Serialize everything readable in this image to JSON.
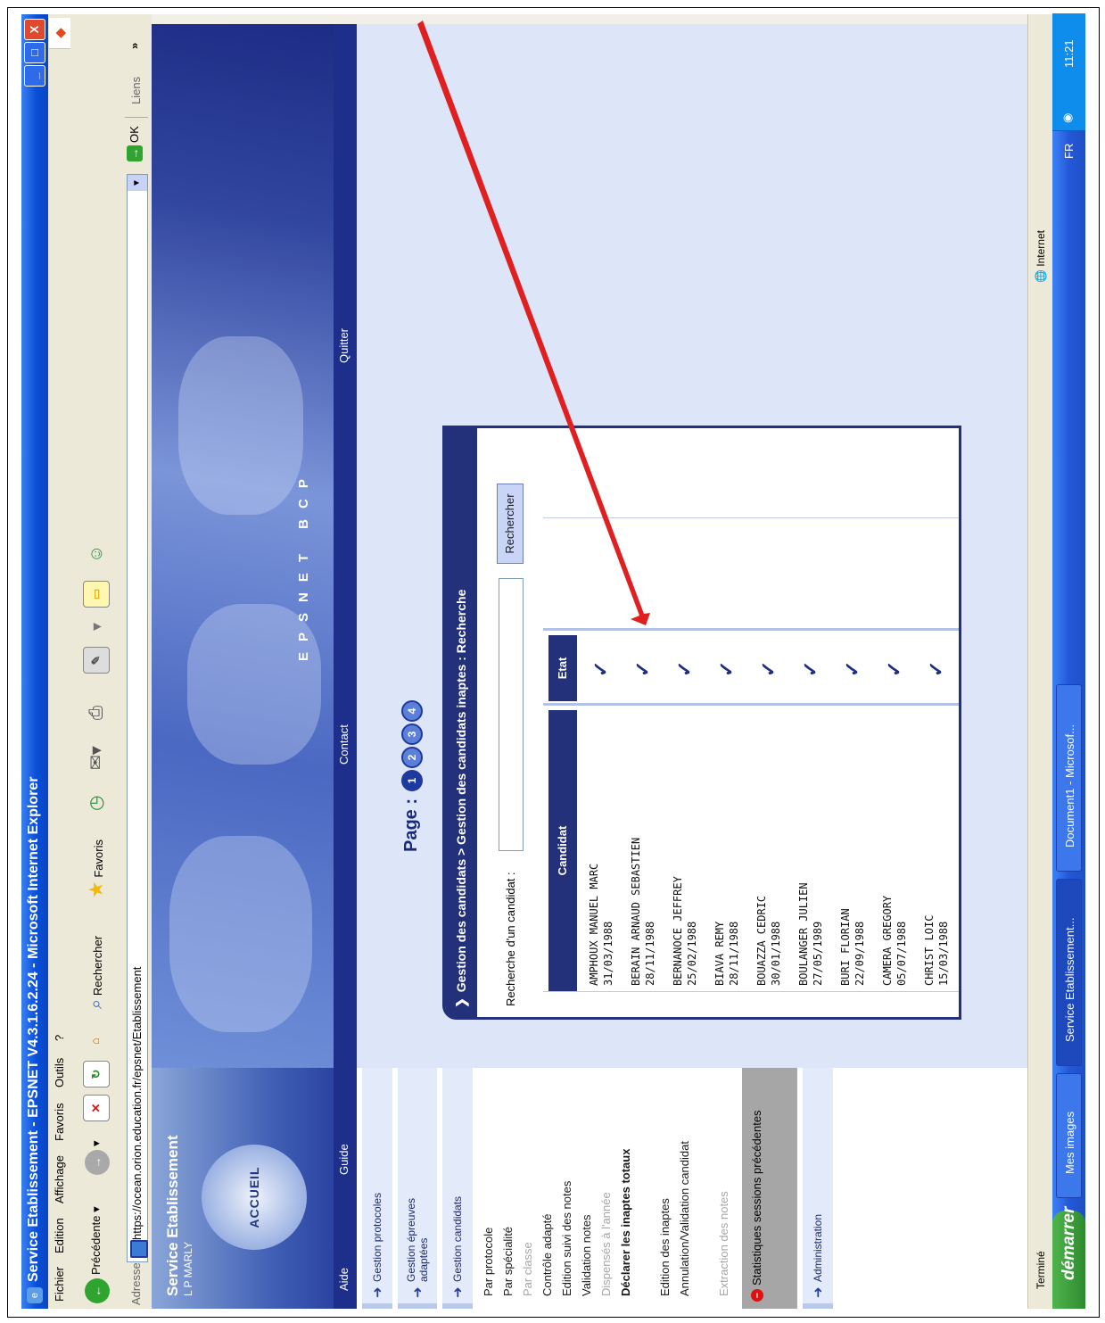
{
  "window": {
    "title": "Service Etablissement - EPSNET V4.3.1.6.2.24 - Microsoft Internet Explorer",
    "minimize": "_",
    "maximize": "□",
    "close": "X"
  },
  "menu": [
    "Fichier",
    "Edition",
    "Affichage",
    "Favoris",
    "Outils",
    "?"
  ],
  "toolbar": {
    "back": "Précédente",
    "search": "Rechercher",
    "favorites": "Favoris"
  },
  "address": {
    "label": "Adresse",
    "url": "https://ocean.orion.education.fr/epsnet/Etablissement",
    "go": "OK",
    "links": "Liens",
    "more": "»"
  },
  "sidebar": {
    "title": "Service Etablissement",
    "subtitle": "L P MARLY",
    "home": "ACCUEIL",
    "nav_left": [
      "Aide",
      "Guide"
    ],
    "sections": {
      "protocoles": "Gestion protocoles",
      "epreuves": "Gestion épreuves adaptées",
      "candidats": "Gestion candidats",
      "administration": "Administration"
    },
    "items": [
      "Par protocole",
      "Par spécialité",
      "Par classe",
      "Contrôle adapté",
      "Edition suivi des notes",
      "Validation notes",
      "Dispensés à l'année",
      "Déclarer les inaptes totaux",
      "Edition des inaptes",
      "Annulation/Validation candidat",
      "Extraction des notes"
    ],
    "stats": "Statistiques sessions précédentes"
  },
  "banner": {
    "brand": "EPSNET BCP",
    "contact": "Contact",
    "quit": "Quitter"
  },
  "main": {
    "page_label": "Page :",
    "pages": [
      "1",
      "2",
      "3",
      "4"
    ],
    "breadcrumb": "Gestion des candidats > Gestion des candidats inaptes : Recherche",
    "search_label": "Recherche d'un candidat :",
    "search_value": "",
    "search_button": "Rechercher",
    "columns": [
      "Candidat",
      "Etat"
    ],
    "rows": [
      {
        "name": "AMPHOUX MANUEL MARC",
        "date": "31/03/1988"
      },
      {
        "name": "BERAIN ARNAUD SEBASTIEN",
        "date": "28/11/1988"
      },
      {
        "name": "BERNANOCE JEFFREY",
        "date": "25/02/1988"
      },
      {
        "name": "BIAVA REMY",
        "date": "28/11/1988"
      },
      {
        "name": "BOUAZZA CEDRIC",
        "date": "30/01/1988"
      },
      {
        "name": "BOULANGER JULIEN",
        "date": "27/05/1989"
      },
      {
        "name": "BURI FLORIAN",
        "date": "22/09/1988"
      },
      {
        "name": "CAMERA GREGORY",
        "date": "05/07/1988"
      },
      {
        "name": "CHRIST LOIC",
        "date": "15/03/1988"
      }
    ],
    "check_glyph": "✓"
  },
  "status": {
    "done": "Terminé",
    "zone": "Internet"
  },
  "taskbar": {
    "start": "démarrer",
    "tasks": [
      "Mes images",
      "Service Etablissement...",
      "Document1 - Microsof..."
    ],
    "lang": "FR",
    "clock": "11:21"
  },
  "colors": {
    "annotation_arrow": "#e02020",
    "header_blue": "#23307a",
    "xp_title": "#0a4fd6"
  }
}
